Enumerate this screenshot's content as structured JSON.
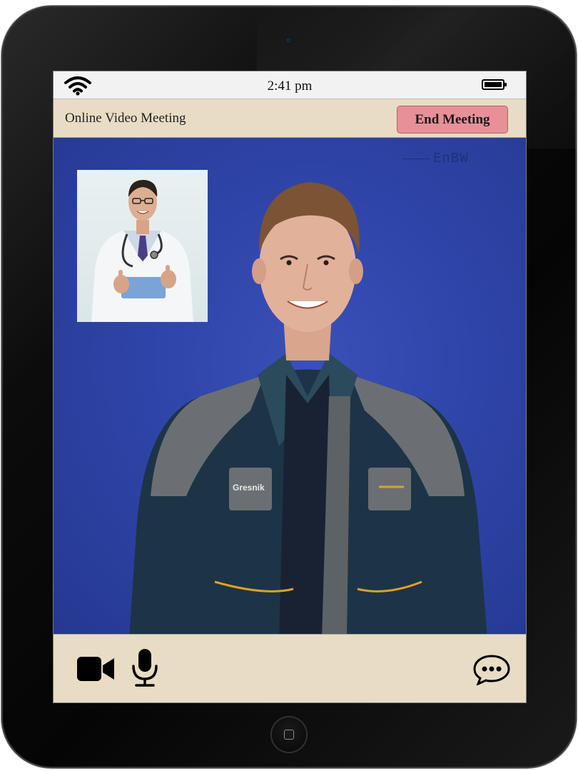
{
  "status_bar": {
    "time": "2:41 pm"
  },
  "header": {
    "title": "Online Video Meeting",
    "end_button_label": "End Meeting"
  },
  "video": {
    "watermark": "EnBW",
    "main_badge_text": "Gresnik",
    "participant": "main-video-participant",
    "self_view": "picture-in-picture-participant"
  },
  "icons": {
    "wifi": "wifi-icon",
    "battery": "battery-icon",
    "camera": "video-camera-icon",
    "mic": "microphone-icon",
    "chat": "chat-bubble-icon"
  },
  "colors": {
    "header_bg": "#e9dcc4",
    "end_button_bg": "#e79098",
    "video_bg": "#2f44a8"
  }
}
